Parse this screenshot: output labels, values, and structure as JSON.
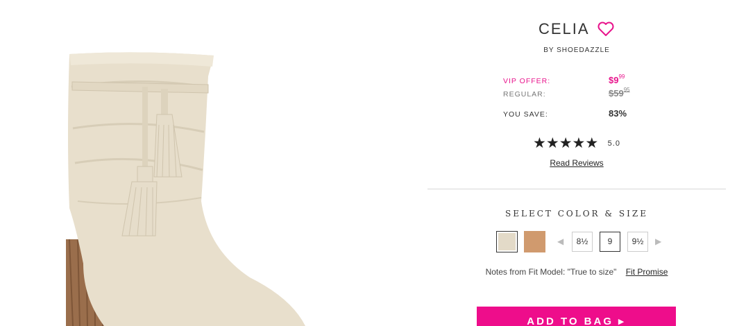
{
  "product": {
    "name": "CELIA",
    "brand": "BY SHOEDAZZLE",
    "heart_icon": "heart-outline-icon"
  },
  "pricing": {
    "vip_label": "VIP OFFER:",
    "vip_price_main": "$9",
    "vip_price_cents": "99",
    "regular_label": "REGULAR:",
    "regular_price_main": "$59",
    "regular_price_cents": "95",
    "save_label": "YOU SAVE:",
    "save_value": "83%"
  },
  "rating": {
    "stars": "★★★★★",
    "value": "5.0",
    "read_reviews": "Read Reviews"
  },
  "selection": {
    "heading": "SELECT COLOR & SIZE",
    "colors": [
      {
        "name": "taupe",
        "hex": "#e3dac8",
        "selected": true
      },
      {
        "name": "cognac",
        "hex": "#d09a6e",
        "selected": false
      }
    ],
    "prev_arrow": "◀",
    "next_arrow": "▶",
    "sizes": [
      "8½",
      "9",
      "9½"
    ],
    "selected_size": "9"
  },
  "fit": {
    "notes": "Notes from Fit Model: \"True to size\"",
    "link": "Fit Promise"
  },
  "cta": {
    "add_to_bag": "ADD TO BAG ▸"
  },
  "colors": {
    "accent": "#ee0d8b",
    "vip_text": "#e8148c"
  }
}
